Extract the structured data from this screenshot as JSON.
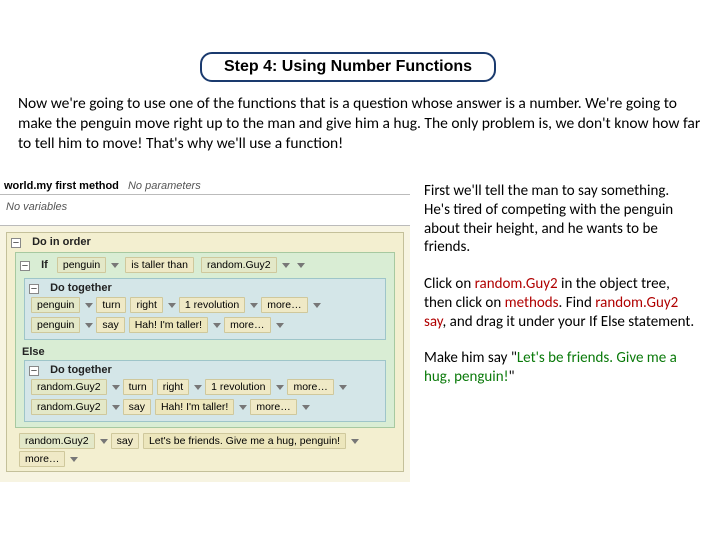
{
  "step_title": "Step 4: Using Number Functions",
  "intro": "Now we're going to use one of the functions that is a question whose answer is a number. We're going to make the penguin move right up to the man and give him a hug. The only problem is, we don't know how far to tell him to move! That's why we'll use a function!",
  "editor": {
    "method_sig_prefix": "world.",
    "method_sig_name": "my first method",
    "method_sig_params": "No parameters",
    "no_vars": "No variables",
    "do_in_order": "Do in order",
    "do_together": "Do together",
    "if_kw": "If",
    "else_kw": "Else",
    "more": "more…",
    "penguin": "penguin",
    "randomGuy2": "random.Guy2",
    "is_taller_than": "is taller than",
    "turn": "turn",
    "right": "right",
    "one_rev": "1 revolution",
    "say": "say",
    "str1": "Hah! I'm taller!",
    "str2": "Let's be friends. Give me a hug, penguin!"
  },
  "side": {
    "p1": "First we'll tell the man to say something. He's tired of competing with the penguin about their height, and he wants to be friends.",
    "p2_a": "Click on ",
    "p2_obj1": "random.Guy2",
    "p2_b": " in the object tree, then click on ",
    "p2_methods": "methods",
    "p2_c": ". Find ",
    "p2_obj2": "random.Guy2 say",
    "p2_d": ", and drag it under your If Else statement.",
    "p3_a": "Make him say \"",
    "p3_quote": "Let's be friends. Give me a hug, penguin!",
    "p3_b": "\""
  }
}
